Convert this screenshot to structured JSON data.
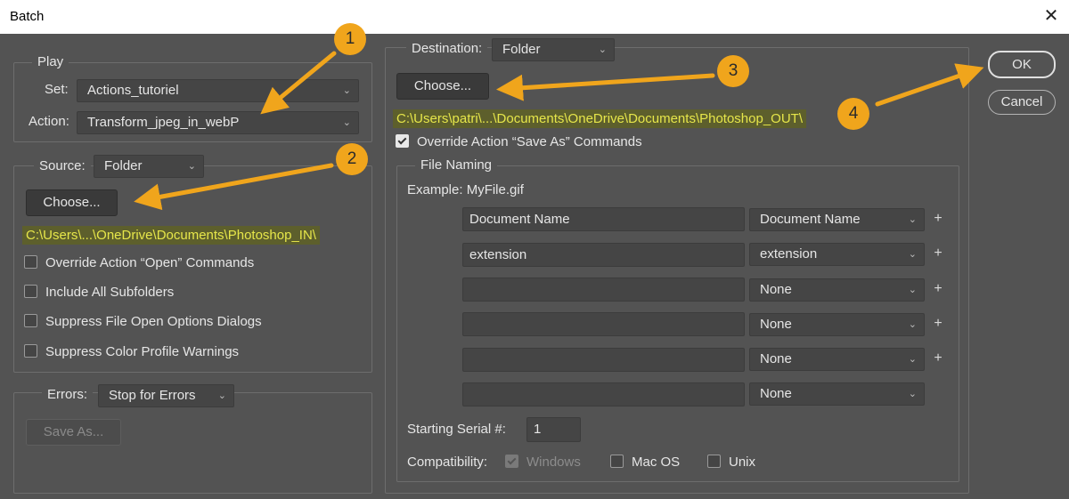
{
  "window": {
    "title": "Batch",
    "close_glyph": "✕"
  },
  "play": {
    "legend": "Play",
    "set_label": "Set:",
    "set_value": "Actions_tutoriel",
    "action_label": "Action:",
    "action_value": "Transform_jpeg_in_webP"
  },
  "source": {
    "label": "Source:",
    "value": "Folder",
    "choose_label": "Choose...",
    "path": "C:\\Users\\...\\OneDrive\\Documents\\Photoshop_IN\\",
    "options": [
      {
        "label": "Override Action “Open” Commands",
        "checked": false
      },
      {
        "label": "Include All Subfolders",
        "checked": false
      },
      {
        "label": "Suppress File Open Options Dialogs",
        "checked": false
      },
      {
        "label": "Suppress Color Profile Warnings",
        "checked": false
      }
    ]
  },
  "errors": {
    "label": "Errors:",
    "value": "Stop for Errors",
    "save_as_label": "Save As..."
  },
  "destination": {
    "label": "Destination:",
    "value": "Folder",
    "choose_label": "Choose...",
    "path": "C:\\Users\\patri\\...\\Documents\\OneDrive\\Documents\\Photoshop_OUT\\",
    "override_label": "Override Action “Save As” Commands",
    "override_checked": true
  },
  "file_naming": {
    "legend": "File Naming",
    "example": "Example: MyFile.gif",
    "rows": [
      {
        "text": "Document Name",
        "select": "Document Name",
        "plus": "+"
      },
      {
        "text": "extension",
        "select": "extension",
        "plus": "+"
      },
      {
        "text": "",
        "select": "None",
        "plus": "+"
      },
      {
        "text": "",
        "select": "None",
        "plus": "+"
      },
      {
        "text": "",
        "select": "None",
        "plus": "+"
      },
      {
        "text": "",
        "select": "None",
        "plus": ""
      }
    ],
    "serial_label": "Starting Serial #:",
    "serial_value": "1",
    "compat_label": "Compatibility:",
    "compat": [
      {
        "label": "Windows",
        "checked": true,
        "disabled": true
      },
      {
        "label": "Mac OS",
        "checked": false,
        "disabled": false
      },
      {
        "label": "Unix",
        "checked": false,
        "disabled": false
      }
    ]
  },
  "buttons": {
    "ok": "OK",
    "cancel": "Cancel"
  },
  "annotations": [
    "1",
    "2",
    "3",
    "4"
  ],
  "colors": {
    "annotation": "#f0a51c",
    "path_highlight": "#e6e64a",
    "background": "#535353"
  }
}
